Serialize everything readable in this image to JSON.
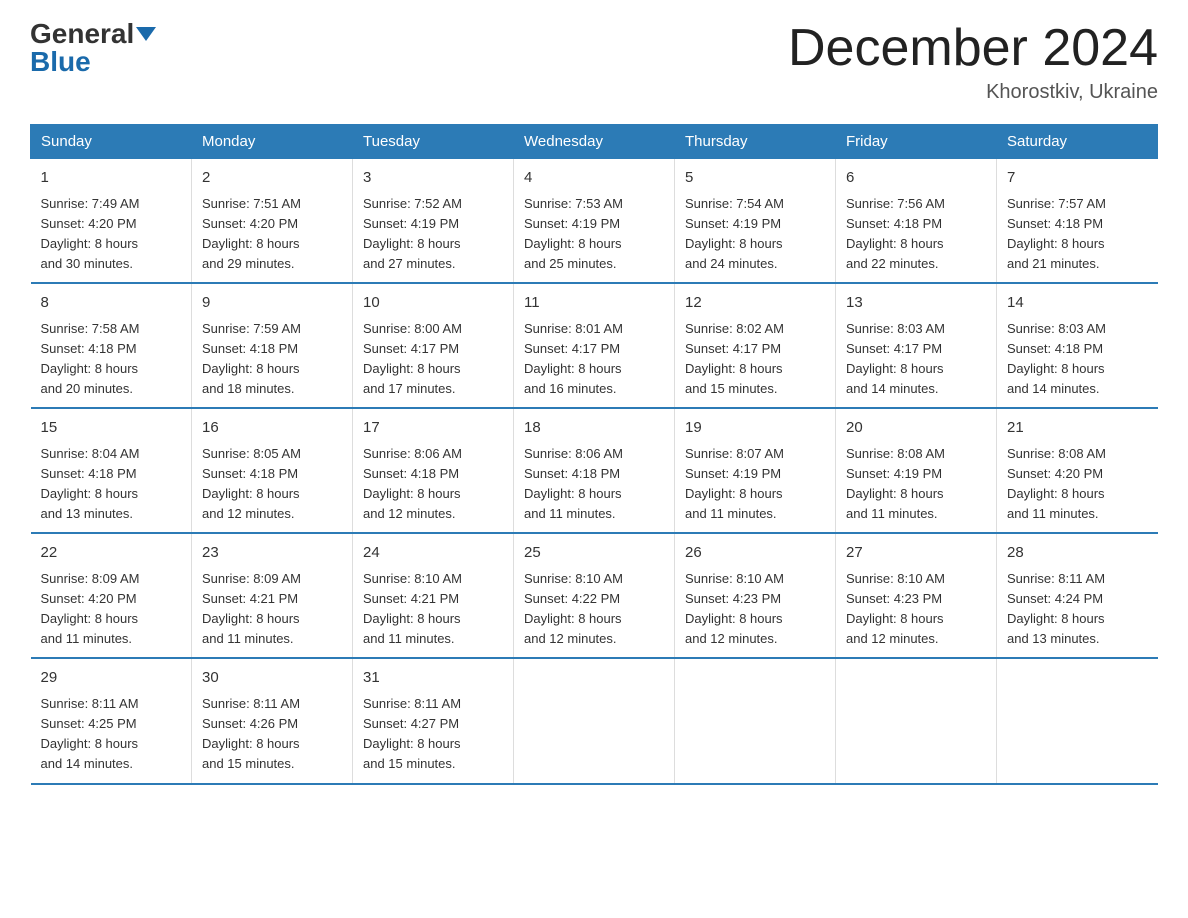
{
  "header": {
    "logo_general": "General",
    "logo_blue": "Blue",
    "month_title": "December 2024",
    "location": "Khorostkiv, Ukraine"
  },
  "days_of_week": [
    "Sunday",
    "Monday",
    "Tuesday",
    "Wednesday",
    "Thursday",
    "Friday",
    "Saturday"
  ],
  "weeks": [
    [
      {
        "day": "1",
        "info": "Sunrise: 7:49 AM\nSunset: 4:20 PM\nDaylight: 8 hours\nand 30 minutes."
      },
      {
        "day": "2",
        "info": "Sunrise: 7:51 AM\nSunset: 4:20 PM\nDaylight: 8 hours\nand 29 minutes."
      },
      {
        "day": "3",
        "info": "Sunrise: 7:52 AM\nSunset: 4:19 PM\nDaylight: 8 hours\nand 27 minutes."
      },
      {
        "day": "4",
        "info": "Sunrise: 7:53 AM\nSunset: 4:19 PM\nDaylight: 8 hours\nand 25 minutes."
      },
      {
        "day": "5",
        "info": "Sunrise: 7:54 AM\nSunset: 4:19 PM\nDaylight: 8 hours\nand 24 minutes."
      },
      {
        "day": "6",
        "info": "Sunrise: 7:56 AM\nSunset: 4:18 PM\nDaylight: 8 hours\nand 22 minutes."
      },
      {
        "day": "7",
        "info": "Sunrise: 7:57 AM\nSunset: 4:18 PM\nDaylight: 8 hours\nand 21 minutes."
      }
    ],
    [
      {
        "day": "8",
        "info": "Sunrise: 7:58 AM\nSunset: 4:18 PM\nDaylight: 8 hours\nand 20 minutes."
      },
      {
        "day": "9",
        "info": "Sunrise: 7:59 AM\nSunset: 4:18 PM\nDaylight: 8 hours\nand 18 minutes."
      },
      {
        "day": "10",
        "info": "Sunrise: 8:00 AM\nSunset: 4:17 PM\nDaylight: 8 hours\nand 17 minutes."
      },
      {
        "day": "11",
        "info": "Sunrise: 8:01 AM\nSunset: 4:17 PM\nDaylight: 8 hours\nand 16 minutes."
      },
      {
        "day": "12",
        "info": "Sunrise: 8:02 AM\nSunset: 4:17 PM\nDaylight: 8 hours\nand 15 minutes."
      },
      {
        "day": "13",
        "info": "Sunrise: 8:03 AM\nSunset: 4:17 PM\nDaylight: 8 hours\nand 14 minutes."
      },
      {
        "day": "14",
        "info": "Sunrise: 8:03 AM\nSunset: 4:18 PM\nDaylight: 8 hours\nand 14 minutes."
      }
    ],
    [
      {
        "day": "15",
        "info": "Sunrise: 8:04 AM\nSunset: 4:18 PM\nDaylight: 8 hours\nand 13 minutes."
      },
      {
        "day": "16",
        "info": "Sunrise: 8:05 AM\nSunset: 4:18 PM\nDaylight: 8 hours\nand 12 minutes."
      },
      {
        "day": "17",
        "info": "Sunrise: 8:06 AM\nSunset: 4:18 PM\nDaylight: 8 hours\nand 12 minutes."
      },
      {
        "day": "18",
        "info": "Sunrise: 8:06 AM\nSunset: 4:18 PM\nDaylight: 8 hours\nand 11 minutes."
      },
      {
        "day": "19",
        "info": "Sunrise: 8:07 AM\nSunset: 4:19 PM\nDaylight: 8 hours\nand 11 minutes."
      },
      {
        "day": "20",
        "info": "Sunrise: 8:08 AM\nSunset: 4:19 PM\nDaylight: 8 hours\nand 11 minutes."
      },
      {
        "day": "21",
        "info": "Sunrise: 8:08 AM\nSunset: 4:20 PM\nDaylight: 8 hours\nand 11 minutes."
      }
    ],
    [
      {
        "day": "22",
        "info": "Sunrise: 8:09 AM\nSunset: 4:20 PM\nDaylight: 8 hours\nand 11 minutes."
      },
      {
        "day": "23",
        "info": "Sunrise: 8:09 AM\nSunset: 4:21 PM\nDaylight: 8 hours\nand 11 minutes."
      },
      {
        "day": "24",
        "info": "Sunrise: 8:10 AM\nSunset: 4:21 PM\nDaylight: 8 hours\nand 11 minutes."
      },
      {
        "day": "25",
        "info": "Sunrise: 8:10 AM\nSunset: 4:22 PM\nDaylight: 8 hours\nand 12 minutes."
      },
      {
        "day": "26",
        "info": "Sunrise: 8:10 AM\nSunset: 4:23 PM\nDaylight: 8 hours\nand 12 minutes."
      },
      {
        "day": "27",
        "info": "Sunrise: 8:10 AM\nSunset: 4:23 PM\nDaylight: 8 hours\nand 12 minutes."
      },
      {
        "day": "28",
        "info": "Sunrise: 8:11 AM\nSunset: 4:24 PM\nDaylight: 8 hours\nand 13 minutes."
      }
    ],
    [
      {
        "day": "29",
        "info": "Sunrise: 8:11 AM\nSunset: 4:25 PM\nDaylight: 8 hours\nand 14 minutes."
      },
      {
        "day": "30",
        "info": "Sunrise: 8:11 AM\nSunset: 4:26 PM\nDaylight: 8 hours\nand 15 minutes."
      },
      {
        "day": "31",
        "info": "Sunrise: 8:11 AM\nSunset: 4:27 PM\nDaylight: 8 hours\nand 15 minutes."
      },
      {
        "day": "",
        "info": ""
      },
      {
        "day": "",
        "info": ""
      },
      {
        "day": "",
        "info": ""
      },
      {
        "day": "",
        "info": ""
      }
    ]
  ]
}
